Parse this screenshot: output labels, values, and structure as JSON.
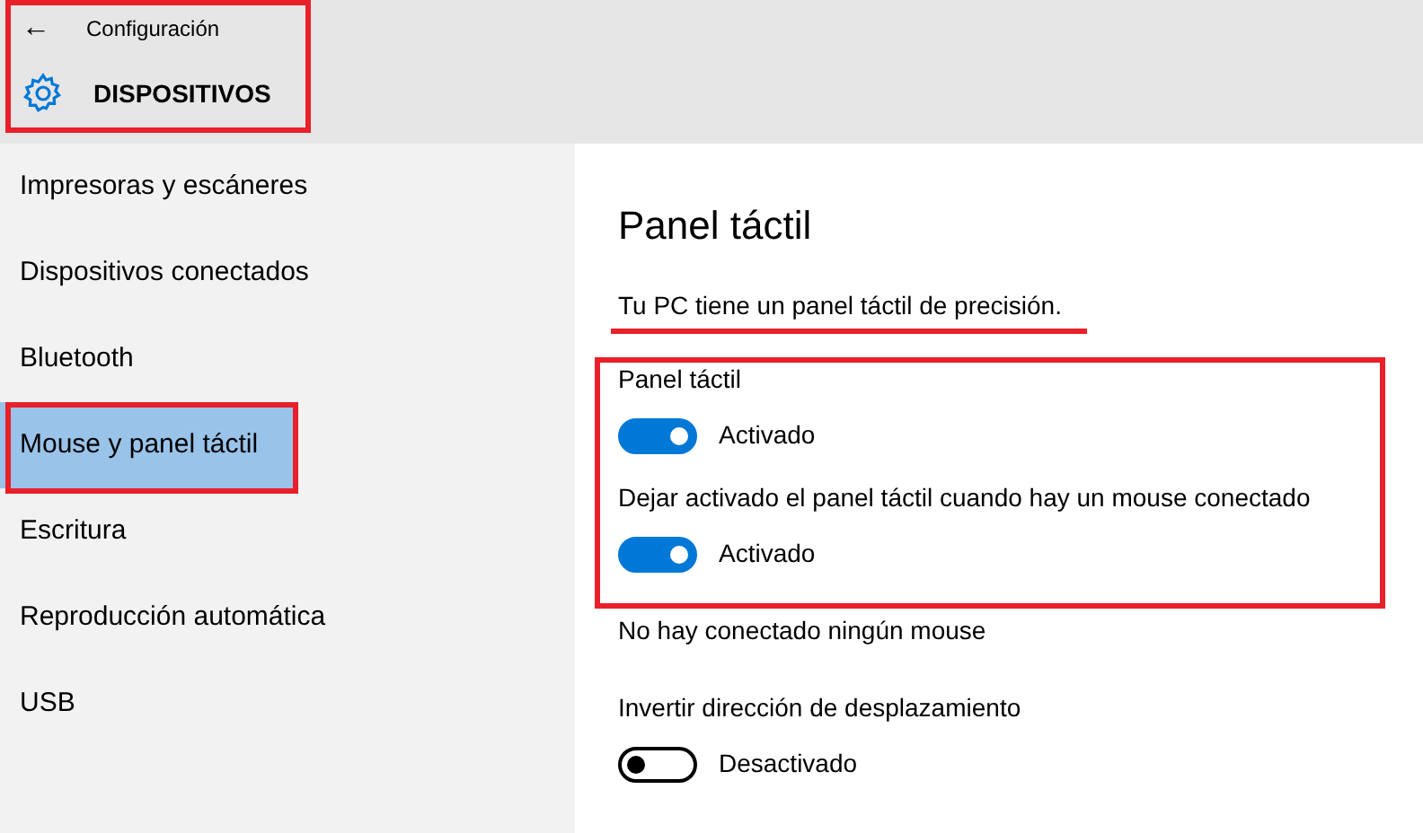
{
  "header": {
    "back": "←",
    "title": "Configuración",
    "section": "DISPOSITIVOS"
  },
  "sidebar": {
    "items": [
      {
        "label": "Impresoras y escáneres",
        "selected": false
      },
      {
        "label": "Dispositivos conectados",
        "selected": false
      },
      {
        "label": "Bluetooth",
        "selected": false
      },
      {
        "label": "Mouse y panel táctil",
        "selected": true
      },
      {
        "label": "Escritura",
        "selected": false
      },
      {
        "label": "Reproducción automática",
        "selected": false
      },
      {
        "label": "USB",
        "selected": false
      }
    ]
  },
  "content": {
    "title": "Panel táctil",
    "note": "Tu PC tiene un panel táctil de precisión.",
    "settings": [
      {
        "kind": "toggle",
        "label": "Panel táctil",
        "on": true,
        "state": "Activado"
      },
      {
        "kind": "toggle",
        "label": "Dejar activado el panel táctil cuando hay un mouse conectado",
        "on": true,
        "state": "Activado"
      },
      {
        "kind": "text",
        "label": "No hay conectado ningún mouse"
      },
      {
        "kind": "toggle",
        "label": "Invertir dirección de desplazamiento",
        "on": false,
        "state": "Desactivado"
      }
    ]
  }
}
